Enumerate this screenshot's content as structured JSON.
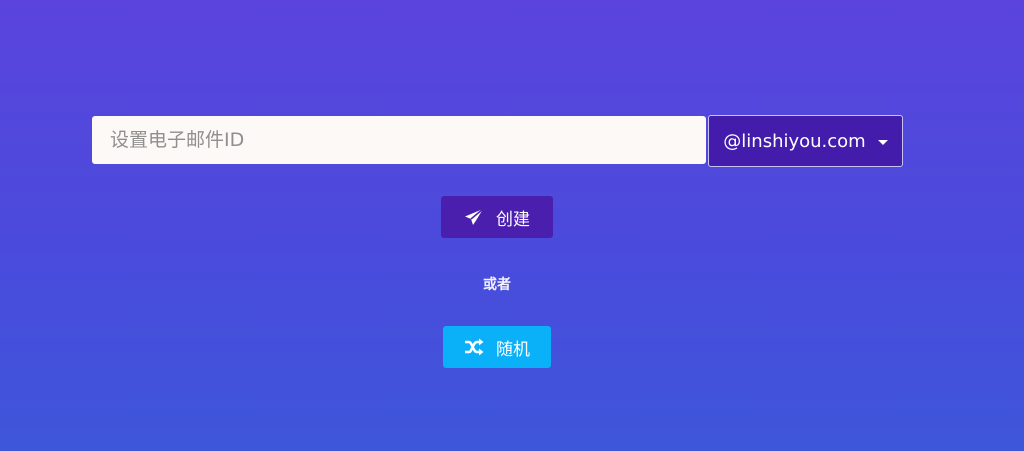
{
  "email_form": {
    "input_value": "",
    "input_placeholder": "设置电子邮件ID",
    "domain_selected": "@linshiyou.com"
  },
  "actions": {
    "create_label": "创建",
    "create_icon": "paper-plane-icon",
    "or_label": "或者",
    "random_label": "随机",
    "random_icon": "shuffle-icon"
  },
  "colors": {
    "background_top": "#5a44dd",
    "background_bottom": "#3e56da",
    "input_bg": "#fdf9f7",
    "domain_button_bg": "#431cab",
    "create_button_bg": "#4b1fae",
    "random_button_bg": "#0ab0f8"
  }
}
